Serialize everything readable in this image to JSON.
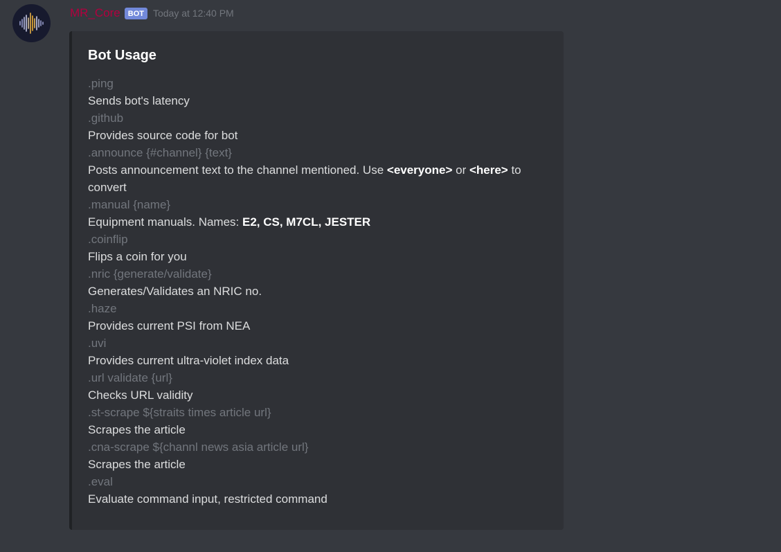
{
  "message": {
    "username": "MR_Core",
    "bot_tag": "BOT",
    "timestamp": "Today at 12:40 PM",
    "username_color": "#b3003f",
    "bot_tag_color": "#7289da",
    "avatar_icon": "waveform-icon"
  },
  "embed": {
    "title": "Bot Usage",
    "accent_color": "#202225",
    "fields": [
      {
        "name": ".ping",
        "value_parts": [
          {
            "text": "Sends bot's latency"
          }
        ]
      },
      {
        "name": ".github",
        "value_parts": [
          {
            "text": "Provides source code for bot"
          }
        ]
      },
      {
        "name": ".announce {#channel} {text}",
        "value_parts": [
          {
            "text": "Posts announcement text to the channel mentioned. Use "
          },
          {
            "text": "<everyone>",
            "bold": true
          },
          {
            "text": " or "
          },
          {
            "text": "<here>",
            "bold": true
          },
          {
            "text": " to convert"
          }
        ]
      },
      {
        "name": ".manual {name}",
        "value_parts": [
          {
            "text": "Equipment manuals. Names: "
          },
          {
            "text": "E2, CS, M7CL, JESTER",
            "bold": true
          }
        ]
      },
      {
        "name": ".coinflip",
        "value_parts": [
          {
            "text": "Flips a coin for you"
          }
        ]
      },
      {
        "name": ".nric {generate/validate}",
        "value_parts": [
          {
            "text": "Generates/Validates an NRIC no."
          }
        ]
      },
      {
        "name": ".haze",
        "value_parts": [
          {
            "text": "Provides current PSI from NEA"
          }
        ]
      },
      {
        "name": ".uvi",
        "value_parts": [
          {
            "text": "Provides current ultra-violet index data"
          }
        ]
      },
      {
        "name": ".url validate {url}",
        "value_parts": [
          {
            "text": "Checks URL validity"
          }
        ]
      },
      {
        "name": ".st-scrape ${straits times article url}",
        "value_parts": [
          {
            "text": "Scrapes the article"
          }
        ]
      },
      {
        "name": ".cna-scrape ${channl news asia article url}",
        "value_parts": [
          {
            "text": "Scrapes the article"
          }
        ]
      },
      {
        "name": ".eval",
        "value_parts": [
          {
            "text": "Evaluate command input, restricted command"
          }
        ]
      }
    ]
  }
}
